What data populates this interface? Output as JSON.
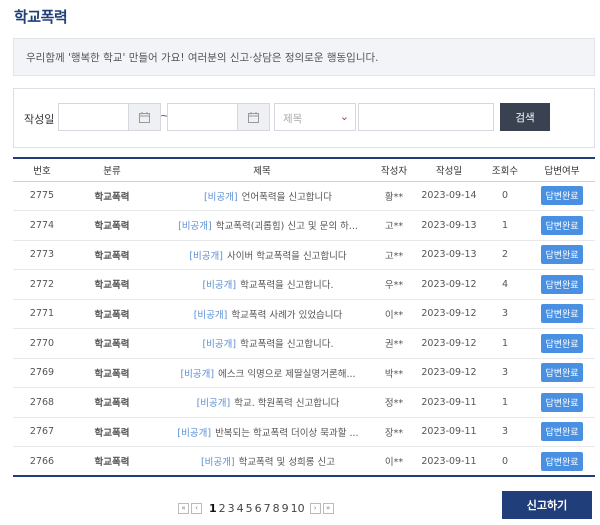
{
  "page": {
    "title": "학교폭력"
  },
  "notice": "우리함께 '행복한 학교' 만들어 가요! 여러분의 신고·상담은 정의로운 행동입니다.",
  "search": {
    "label": "작성일",
    "date_separator": "~",
    "calendar_icon": "calendar-icon",
    "field_select": "제목",
    "keyword_placeholder": "",
    "button": "검색"
  },
  "table": {
    "headers": [
      "번호",
      "분류",
      "제목",
      "작성자",
      "작성일",
      "조회수",
      "답변여부"
    ],
    "rows": [
      {
        "no": "2775",
        "category": "학교폭력",
        "private": "[비공개]",
        "title": "언어폭력을 신고합니다",
        "author": "황**",
        "date": "2023-09-14",
        "views": "0",
        "answer": "답변완료"
      },
      {
        "no": "2774",
        "category": "학교폭력",
        "private": "[비공개]",
        "title": "학교폭력(괴롭힘) 신고 및 문의 하...",
        "author": "고**",
        "date": "2023-09-13",
        "views": "1",
        "answer": "답변완료"
      },
      {
        "no": "2773",
        "category": "학교폭력",
        "private": "[비공개]",
        "title": "사이버 학교폭력을 신고합니다",
        "author": "고**",
        "date": "2023-09-13",
        "views": "2",
        "answer": "답변완료"
      },
      {
        "no": "2772",
        "category": "학교폭력",
        "private": "[비공개]",
        "title": "학교폭력을 신고합니다.",
        "author": "우**",
        "date": "2023-09-12",
        "views": "4",
        "answer": "답변완료"
      },
      {
        "no": "2771",
        "category": "학교폭력",
        "private": "[비공개]",
        "title": "학교폭력 사례가 있었습니다",
        "author": "이**",
        "date": "2023-09-12",
        "views": "3",
        "answer": "답변완료"
      },
      {
        "no": "2770",
        "category": "학교폭력",
        "private": "[비공개]",
        "title": "학교폭력을 신고합니다.",
        "author": "권**",
        "date": "2023-09-12",
        "views": "1",
        "answer": "답변완료"
      },
      {
        "no": "2769",
        "category": "학교폭력",
        "private": "[비공개]",
        "title": "에스크 익명으로 제딸실명거론해...",
        "author": "박**",
        "date": "2023-09-12",
        "views": "3",
        "answer": "답변완료"
      },
      {
        "no": "2768",
        "category": "학교폭력",
        "private": "[비공개]",
        "title": "학교. 학원폭력 신고합니다",
        "author": "정**",
        "date": "2023-09-11",
        "views": "1",
        "answer": "답변완료"
      },
      {
        "no": "2767",
        "category": "학교폭력",
        "private": "[비공개]",
        "title": "반복되는 학교폭력 더이상 묵과할 ...",
        "author": "장**",
        "date": "2023-09-11",
        "views": "3",
        "answer": "답변완료"
      },
      {
        "no": "2766",
        "category": "학교폭력",
        "private": "[비공개]",
        "title": "학교폭력 및 성희롱 신고",
        "author": "이**",
        "date": "2023-09-11",
        "views": "0",
        "answer": "답변완료"
      }
    ]
  },
  "pagination": {
    "first": "«",
    "prev": "‹",
    "pages": [
      "1",
      "2",
      "3",
      "4",
      "5",
      "6",
      "7",
      "8",
      "9",
      "10"
    ],
    "current": "1",
    "next": "›",
    "last": "»"
  },
  "report_button": "신고하기",
  "colors": {
    "primary": "#1f3e7a",
    "badge": "#4a90e2",
    "private": "#5b8fd4",
    "search_button": "#3a4150"
  }
}
